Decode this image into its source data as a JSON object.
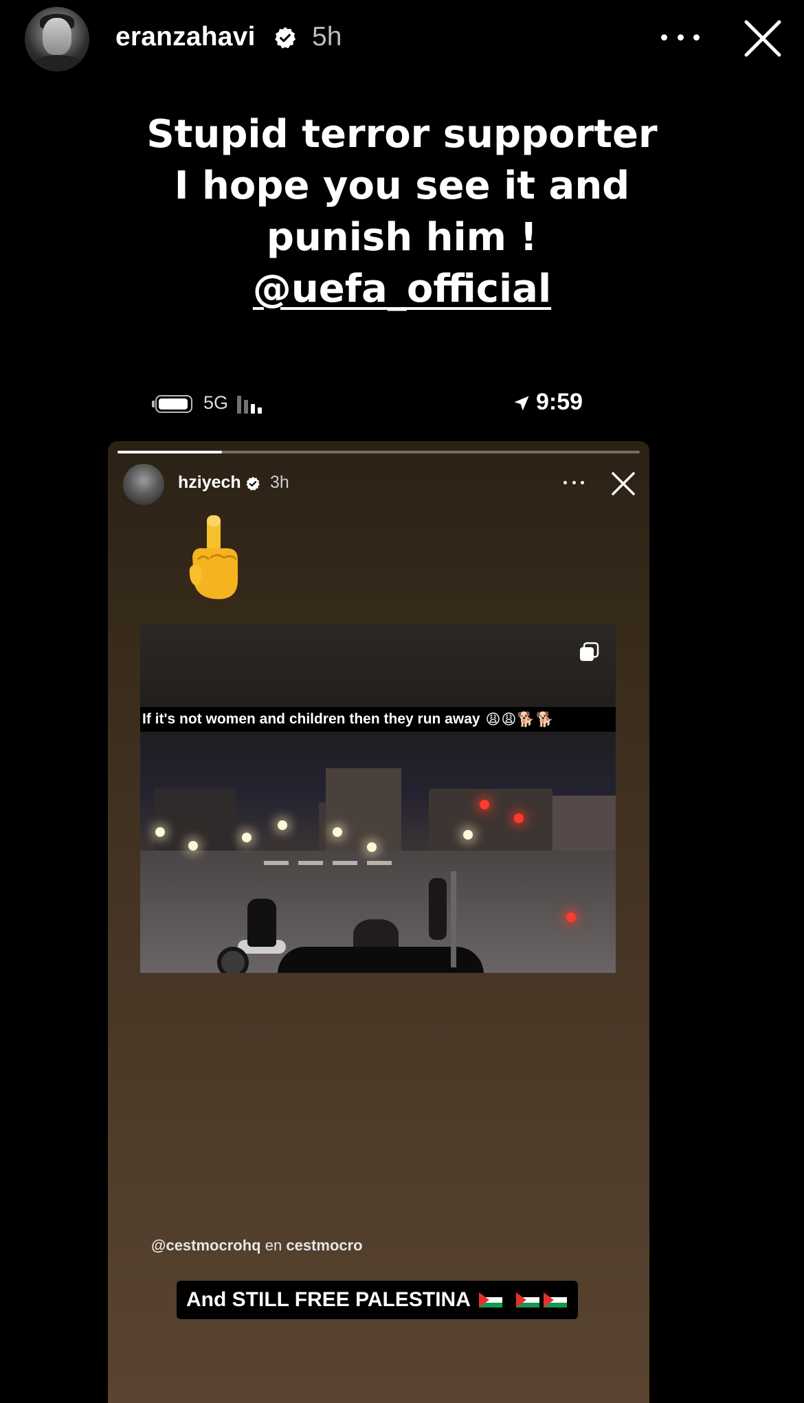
{
  "story": {
    "username": "eranzahavi",
    "time": "5h",
    "caption_lines": [
      "Stupid terror supporter",
      "I hope you see it and",
      "punish him !"
    ],
    "mention": "@uefa_official"
  },
  "embedded_status_bar": {
    "network": "5G",
    "clock": "9:59"
  },
  "embedded_story": {
    "username": "hziyech",
    "time": "3h",
    "progress": 0.2,
    "finger_emoji": "🖕",
    "video_text": "If it's not women and children then they run away",
    "video_emojis": "😩😩🐕🐕",
    "credit_handle": "@cestmocrohq",
    "credit_middle": "en",
    "credit_account": "cestmocro",
    "sticker_text": "And STILL FREE PALESTINA"
  },
  "icons": [
    "verified-badge-icon",
    "more-options-icon",
    "close-icon",
    "battery-icon",
    "signal-icon",
    "location-arrow-icon",
    "copy-icon",
    "palestine-flag-icon"
  ]
}
